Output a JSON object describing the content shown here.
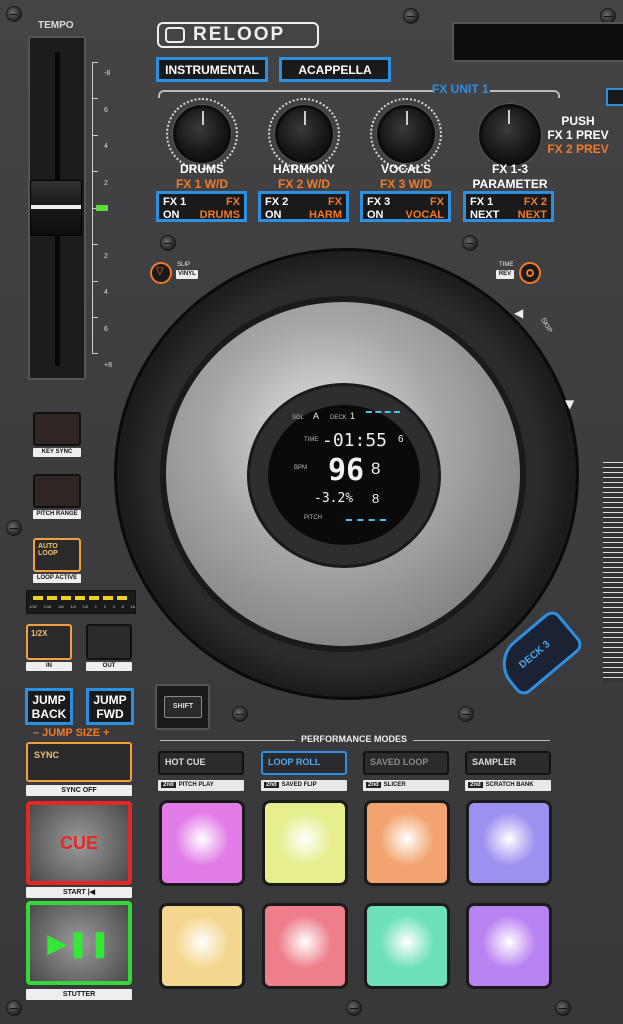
{
  "brand": "RELOOP",
  "tempo": {
    "label": "TEMPO",
    "scale_left": [
      "-8",
      "6",
      "4",
      "2",
      "0",
      "2",
      "4",
      "6",
      "+8"
    ]
  },
  "top_buttons": {
    "instrumental": "INSTRUMENTAL",
    "acappella": "ACAPPELLA"
  },
  "fx_unit_label": "FX UNIT 1",
  "knobs": [
    {
      "name": "DRUMS",
      "sub": "FX 1 W/D"
    },
    {
      "name": "HARMONY",
      "sub": "FX 2 W/D"
    },
    {
      "name": "VOCALS",
      "sub": "FX 3 W/D"
    },
    {
      "name": "FX 1-3",
      "sub": "PARAMETER"
    }
  ],
  "push_label": {
    "push": "PUSH",
    "fx1prev": "FX 1 PREV",
    "fx2prev": "FX 2 PREV"
  },
  "fx_buttons": [
    {
      "l1": "FX 1",
      "l2": "ON",
      "r1": "FX",
      "r2": "DRUMS"
    },
    {
      "l1": "FX 2",
      "l2": "ON",
      "r1": "FX",
      "r2": "HARM"
    },
    {
      "l1": "FX 3",
      "l2": "ON",
      "r1": "FX",
      "r2": "VOCAL"
    },
    {
      "l1": "FX 1",
      "l2": "NEXT",
      "r1": "FX 2",
      "r2": "NEXT"
    }
  ],
  "slip": {
    "top": "SLIP",
    "bottom": "VINYL"
  },
  "time": {
    "top": "TIME",
    "bottom": "REV"
  },
  "display": {
    "time_label": "TIME",
    "time_value": "-01:55",
    "time_sub": "6",
    "bpm_label": "BPM",
    "bpm_value": "96",
    "bpm_decimal": "8",
    "pitch_value": "-3.2%",
    "pitch_range": "8",
    "pitch_label": "PITCH",
    "deck_label": "DECK",
    "deck_num": "1",
    "sync_label": "SGL",
    "a_label": "A"
  },
  "skip_label": "SKIP",
  "deck3_label": "DECK 3",
  "left_column": {
    "key_sync": "KEY SYNC",
    "pitch_range": "PITCH RANGE",
    "auto_loop": "AUTO\nLOOP",
    "loop_active": "LOOP ACTIVE",
    "loop_scale": [
      "1/32",
      "1/16",
      "1/8",
      "1/4",
      "1/2",
      "1",
      "2",
      "4",
      "8",
      "16"
    ],
    "in_btn": "1/2X",
    "in": "IN",
    "out": "OUT"
  },
  "jump": {
    "back": "JUMP\nBACK",
    "fwd": "JUMP\nFWD",
    "size": "– JUMP SIZE +"
  },
  "shift": "SHIFT",
  "sync": {
    "label": "SYNC",
    "sub": "SYNC OFF"
  },
  "cue": {
    "label": "CUE",
    "sub": "START |◀"
  },
  "play": {
    "sub": "STUTTER"
  },
  "performance_modes": {
    "title": "PERFORMANCE MODES",
    "modes": [
      {
        "label": "HOT CUE",
        "sub": "PITCH PLAY"
      },
      {
        "label": "LOOP ROLL",
        "sub": "SAVED FLIP"
      },
      {
        "label": "SAVED LOOP",
        "sub": "SLICER"
      },
      {
        "label": "SAMPLER",
        "sub": "SCRATCH BANK"
      }
    ],
    "second_label": "2nd"
  },
  "pad_colors": [
    "#e27ce8",
    "#e6ee8e",
    "#f3a470",
    "#9c90f0",
    "#f4d68e",
    "#ee7e8a",
    "#6ee0bc",
    "#b882f2"
  ],
  "colors": {
    "accent_blue": "#2c8fe0",
    "orange": "#f07a2a",
    "cue_red": "#e02828",
    "play_green": "#34d838"
  }
}
